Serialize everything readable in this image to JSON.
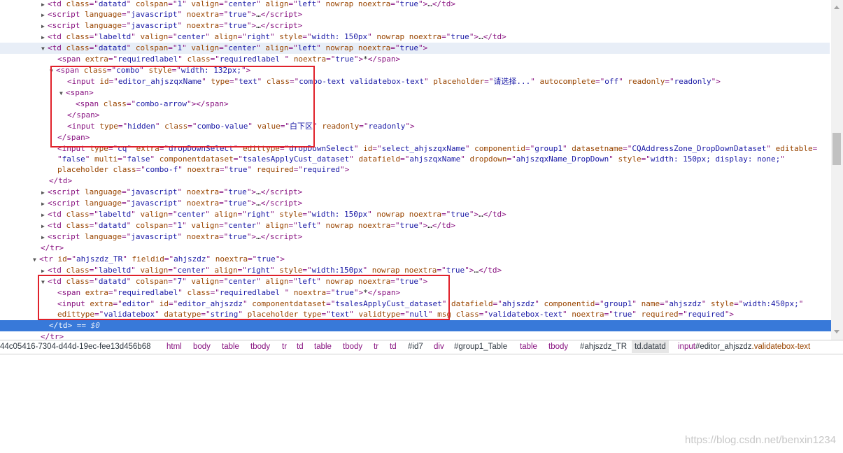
{
  "elements": {
    "lines": [
      {
        "arrow": "▶",
        "html": "<span class=\"tag\">&lt;td </span><span class=\"an\">class</span><span class=\"tag\">=\"</span><span class=\"av\">datatd</span><span class=\"tag\">\" </span><span class=\"an\">colspan</span><span class=\"tag\">=\"</span><span class=\"av\">1</span><span class=\"tag\">\" </span><span class=\"an\">valign</span><span class=\"tag\">=\"</span><span class=\"av\">center</span><span class=\"tag\">\" </span><span class=\"an\">align</span><span class=\"tag\">=\"</span><span class=\"av\">left</span><span class=\"tag\">\" </span><span class=\"an\">nowrap noextra</span><span class=\"tag\">=\"</span><span class=\"av\">true</span><span class=\"tag\">\"&gt;</span>…<span class=\"tag\">&lt;/td&gt;</span>"
      },
      {
        "arrow": "▶",
        "html": "<span class=\"tag\">&lt;script </span><span class=\"an\">language</span><span class=\"tag\">=\"</span><span class=\"av\">javascript</span><span class=\"tag\">\" </span><span class=\"an\">noextra</span><span class=\"tag\">=\"</span><span class=\"av\">true</span><span class=\"tag\">\"&gt;</span>…<span class=\"tag\">&lt;/script&gt;</span>"
      },
      {
        "arrow": "▶",
        "html": "<span class=\"tag\">&lt;script </span><span class=\"an\">language</span><span class=\"tag\">=\"</span><span class=\"av\">javascript</span><span class=\"tag\">\" </span><span class=\"an\">noextra</span><span class=\"tag\">=\"</span><span class=\"av\">true</span><span class=\"tag\">\"&gt;</span>…<span class=\"tag\">&lt;/script&gt;</span>"
      },
      {
        "arrow": "▶",
        "html": "<span class=\"tag\">&lt;td </span><span class=\"an\">class</span><span class=\"tag\">=\"</span><span class=\"av\">labeltd</span><span class=\"tag\">\" </span><span class=\"an\">valign</span><span class=\"tag\">=\"</span><span class=\"av\">center</span><span class=\"tag\">\" </span><span class=\"an\">align</span><span class=\"tag\">=\"</span><span class=\"av\">right</span><span class=\"tag\">\" </span><span class=\"an\">style</span><span class=\"tag\">=\"</span><span class=\"av\">width: 150px</span><span class=\"tag\">\" </span><span class=\"an\">nowrap noextra</span><span class=\"tag\">=\"</span><span class=\"av\">true</span><span class=\"tag\">\"&gt;</span>…<span class=\"tag\">&lt;/td&gt;</span>"
      },
      {
        "arrow": "▼",
        "html": "<span class=\"tag\">&lt;td </span><span class=\"an\">class</span><span class=\"tag\">=\"</span><span class=\"av\">datatd</span><span class=\"tag\">\" </span><span class=\"an\">colspan</span><span class=\"tag\">=\"</span><span class=\"av\">1</span><span class=\"tag\">\" </span><span class=\"an\">valign</span><span class=\"tag\">=\"</span><span class=\"av\">center</span><span class=\"tag\">\" </span><span class=\"an\">align</span><span class=\"tag\">=\"</span><span class=\"av\">left</span><span class=\"tag\">\" </span><span class=\"an\">nowrap noextra</span><span class=\"tag\">=\"</span><span class=\"av\">true</span><span class=\"tag\">\"&gt;</span>"
      },
      {
        "arrow": "",
        "html": "<span class=\"tag\">&lt;span </span><span class=\"an\">extra</span><span class=\"tag\">=\"</span><span class=\"av\">requiredlabel</span><span class=\"tag\">\" </span><span class=\"an\">class</span><span class=\"tag\">=\"</span><span class=\"av\">requiredlabel </span><span class=\"tag\">\" </span><span class=\"an\">noextra</span><span class=\"tag\">=\"</span><span class=\"av\">true</span><span class=\"tag\">\"&gt;</span>*<span class=\"tag\">&lt;/span&gt;</span>"
      },
      {
        "arrow": "▼",
        "html": "<span class=\"tag\">&lt;span </span><span class=\"an\">class</span><span class=\"tag\">=\"</span><span class=\"av\">combo</span><span class=\"tag\">\" </span><span class=\"an\">style</span><span class=\"tag\">=\"</span><span class=\"av\">width: 132px;</span><span class=\"tag\">\"&gt;</span>"
      },
      {
        "arrow": "",
        "html": "<span class=\"tag\">&lt;input </span><span class=\"an\">id</span><span class=\"tag\">=\"</span><span class=\"av\">editor_ahjszqxName</span><span class=\"tag\">\" </span><span class=\"an\">type</span><span class=\"tag\">=\"</span><span class=\"av\">text</span><span class=\"tag\">\" </span><span class=\"an\">class</span><span class=\"tag\">=\"</span><span class=\"av\">combo-text validatebox-text</span><span class=\"tag\">\" </span><span class=\"an\">placeholder</span><span class=\"tag\">=\"</span><span class=\"av\">请选择...</span><span class=\"tag\">\" </span><span class=\"an\">autocomplete</span><span class=\"tag\">=\"</span><span class=\"av\">off</span><span class=\"tag\">\" </span><span class=\"an\">readonly</span><span class=\"tag\">=\"</span><span class=\"av\">readonly</span><span class=\"tag\">\"&gt;</span>"
      },
      {
        "arrow": "▼",
        "html": "<span class=\"tag\">&lt;span&gt;</span>"
      },
      {
        "arrow": "",
        "html": "<span class=\"tag\">&lt;span </span><span class=\"an\">class</span><span class=\"tag\">=\"</span><span class=\"av\">combo-arrow</span><span class=\"tag\">\"&gt;&lt;/span&gt;</span>"
      },
      {
        "arrow": "",
        "html": "<span class=\"tag\">&lt;/span&gt;</span>"
      },
      {
        "arrow": "",
        "html": "<span class=\"tag\">&lt;input </span><span class=\"an\">type</span><span class=\"tag\">=\"</span><span class=\"av\">hidden</span><span class=\"tag\">\" </span><span class=\"an\">class</span><span class=\"tag\">=\"</span><span class=\"av\">combo-value</span><span class=\"tag\">\" </span><span class=\"an\">value</span><span class=\"tag\">=\"</span><span class=\"av\">白下区</span><span class=\"tag\">\" </span><span class=\"an\">readonly</span><span class=\"tag\">=\"</span><span class=\"av\">readonly</span><span class=\"tag\">\"&gt;</span>"
      },
      {
        "arrow": "",
        "html": "<span class=\"tag\">&lt;/span&gt;</span>"
      },
      {
        "arrow": "",
        "html": "<span class=\"tag\">&lt;input </span><span class=\"an\">type</span><span class=\"tag\">=\"</span><span class=\"av\">cq</span><span class=\"tag\">\" </span><span class=\"an\">extra</span><span class=\"tag\">=\"</span><span class=\"av\">dropDownSelect</span><span class=\"tag\">\" </span><span class=\"an\">edittype</span><span class=\"tag\">=\"</span><span class=\"av\">dropDownSelect</span><span class=\"tag\">\" </span><span class=\"an\">id</span><span class=\"tag\">=\"</span><span class=\"av\">select_ahjszqxName</span><span class=\"tag\">\" </span><span class=\"an\">componentid</span><span class=\"tag\">=\"</span><span class=\"av\">group1</span><span class=\"tag\">\" </span><span class=\"an\">datasetname</span><span class=\"tag\">=\"</span><span class=\"av\">CQAddressZone_DropDownDataset</span><span class=\"tag\">\" </span><span class=\"an\">editable</span><span class=\"tag\">=</span>"
      },
      {
        "arrow": "",
        "html": "<span class=\"tag\">\"</span><span class=\"av\">false</span><span class=\"tag\">\" </span><span class=\"an\">multi</span><span class=\"tag\">=\"</span><span class=\"av\">false</span><span class=\"tag\">\" </span><span class=\"an\">componentdataset</span><span class=\"tag\">=\"</span><span class=\"av\">tsalesApplyCust_dataset</span><span class=\"tag\">\" </span><span class=\"an\">datafield</span><span class=\"tag\">=\"</span><span class=\"av\">ahjszqxName</span><span class=\"tag\">\" </span><span class=\"an\">dropdown</span><span class=\"tag\">=\"</span><span class=\"av\">ahjszqxName_DropDown</span><span class=\"tag\">\" </span><span class=\"an\">style</span><span class=\"tag\">=\"</span><span class=\"av\">width: 150px; display: none;</span><span class=\"tag\">\"</span>"
      },
      {
        "arrow": "",
        "html": "<span class=\"an\">placeholder class</span><span class=\"tag\">=\"</span><span class=\"av\">combo-f</span><span class=\"tag\">\" </span><span class=\"an\">noextra</span><span class=\"tag\">=\"</span><span class=\"av\">true</span><span class=\"tag\">\" </span><span class=\"an\">required</span><span class=\"tag\">=\"</span><span class=\"av\">required</span><span class=\"tag\">\"&gt;</span>"
      },
      {
        "arrow": "",
        "html": "<span class=\"tag\">&lt;/td&gt;</span>"
      },
      {
        "arrow": "▶",
        "html": "<span class=\"tag\">&lt;script </span><span class=\"an\">language</span><span class=\"tag\">=\"</span><span class=\"av\">javascript</span><span class=\"tag\">\" </span><span class=\"an\">noextra</span><span class=\"tag\">=\"</span><span class=\"av\">true</span><span class=\"tag\">\"&gt;</span>…<span class=\"tag\">&lt;/script&gt;</span>"
      },
      {
        "arrow": "▶",
        "html": "<span class=\"tag\">&lt;script </span><span class=\"an\">language</span><span class=\"tag\">=\"</span><span class=\"av\">javascript</span><span class=\"tag\">\" </span><span class=\"an\">noextra</span><span class=\"tag\">=\"</span><span class=\"av\">true</span><span class=\"tag\">\"&gt;</span>…<span class=\"tag\">&lt;/script&gt;</span>"
      },
      {
        "arrow": "▶",
        "html": "<span class=\"tag\">&lt;td </span><span class=\"an\">class</span><span class=\"tag\">=\"</span><span class=\"av\">labeltd</span><span class=\"tag\">\" </span><span class=\"an\">valign</span><span class=\"tag\">=\"</span><span class=\"av\">center</span><span class=\"tag\">\" </span><span class=\"an\">align</span><span class=\"tag\">=\"</span><span class=\"av\">right</span><span class=\"tag\">\" </span><span class=\"an\">style</span><span class=\"tag\">=\"</span><span class=\"av\">width: 150px</span><span class=\"tag\">\" </span><span class=\"an\">nowrap noextra</span><span class=\"tag\">=\"</span><span class=\"av\">true</span><span class=\"tag\">\"&gt;</span>…<span class=\"tag\">&lt;/td&gt;</span>"
      },
      {
        "arrow": "▶",
        "html": "<span class=\"tag\">&lt;td </span><span class=\"an\">class</span><span class=\"tag\">=\"</span><span class=\"av\">datatd</span><span class=\"tag\">\" </span><span class=\"an\">colspan</span><span class=\"tag\">=\"</span><span class=\"av\">1</span><span class=\"tag\">\" </span><span class=\"an\">valign</span><span class=\"tag\">=\"</span><span class=\"av\">center</span><span class=\"tag\">\" </span><span class=\"an\">align</span><span class=\"tag\">=\"</span><span class=\"av\">left</span><span class=\"tag\">\" </span><span class=\"an\">nowrap noextra</span><span class=\"tag\">=\"</span><span class=\"av\">true</span><span class=\"tag\">\"&gt;</span>…<span class=\"tag\">&lt;/td&gt;</span>"
      },
      {
        "arrow": "▶",
        "html": "<span class=\"tag\">&lt;script </span><span class=\"an\">language</span><span class=\"tag\">=\"</span><span class=\"av\">javascript</span><span class=\"tag\">\" </span><span class=\"an\">noextra</span><span class=\"tag\">=\"</span><span class=\"av\">true</span><span class=\"tag\">\"&gt;</span>…<span class=\"tag\">&lt;/script&gt;</span>"
      },
      {
        "arrow": "",
        "html": "<span class=\"tag\">&lt;/tr&gt;</span>"
      },
      {
        "arrow": "▼",
        "html": "<span class=\"tag\">&lt;tr </span><span class=\"an\">id</span><span class=\"tag\">=\"</span><span class=\"av\">ahjszdz_TR</span><span class=\"tag\">\" </span><span class=\"an\">fieldid</span><span class=\"tag\">=\"</span><span class=\"av\">ahjszdz</span><span class=\"tag\">\" </span><span class=\"an\">noextra</span><span class=\"tag\">=\"</span><span class=\"av\">true</span><span class=\"tag\">\"&gt;</span>"
      },
      {
        "arrow": "▶",
        "html": "<span class=\"tag\">&lt;td </span><span class=\"an\">class</span><span class=\"tag\">=\"</span><span class=\"av\">labeltd</span><span class=\"tag\">\" </span><span class=\"an\">valign</span><span class=\"tag\">=\"</span><span class=\"av\">center</span><span class=\"tag\">\" </span><span class=\"an\">align</span><span class=\"tag\">=\"</span><span class=\"av\">right</span><span class=\"tag\">\" </span><span class=\"an\">style</span><span class=\"tag\">=\"</span><span class=\"av\">width:150px</span><span class=\"tag\">\" </span><span class=\"an\">nowrap noextra</span><span class=\"tag\">=\"</span><span class=\"av\">true</span><span class=\"tag\">\"&gt;</span>…<span class=\"tag\">&lt;/td&gt;</span>"
      },
      {
        "arrow": "▼",
        "html": "<span class=\"tag\">&lt;td </span><span class=\"an\">class</span><span class=\"tag\">=\"</span><span class=\"av\">datatd</span><span class=\"tag\">\" </span><span class=\"an\">colspan</span><span class=\"tag\">=\"</span><span class=\"av\">7</span><span class=\"tag\">\" </span><span class=\"an\">valign</span><span class=\"tag\">=\"</span><span class=\"av\">center</span><span class=\"tag\">\" </span><span class=\"an\">align</span><span class=\"tag\">=\"</span><span class=\"av\">left</span><span class=\"tag\">\" </span><span class=\"an\">nowrap noextra</span><span class=\"tag\">=\"</span><span class=\"av\">true</span><span class=\"tag\">\"&gt;</span>"
      },
      {
        "arrow": "",
        "html": "<span class=\"tag\">&lt;span </span><span class=\"an\">extra</span><span class=\"tag\">=\"</span><span class=\"av\">requiredlabel</span><span class=\"tag\">\" </span><span class=\"an\">class</span><span class=\"tag\">=\"</span><span class=\"av\">requiredlabel </span><span class=\"tag\">\" </span><span class=\"an\">noextra</span><span class=\"tag\">=\"</span><span class=\"av\">true</span><span class=\"tag\">\"&gt;</span>*<span class=\"tag\">&lt;/span&gt;</span>"
      },
      {
        "arrow": "",
        "html": "<span class=\"tag\">&lt;input </span><span class=\"an\">extra</span><span class=\"tag\">=\"</span><span class=\"av\">editor</span><span class=\"tag\">\" </span><span class=\"an\">id</span><span class=\"tag\">=\"</span><span class=\"av\">editor_ahjszdz</span><span class=\"tag\">\" </span><span class=\"an\">componentdataset</span><span class=\"tag\">=\"</span><span class=\"av\">tsalesApplyCust_dataset</span><span class=\"tag\">\" </span><span class=\"an\">datafield</span><span class=\"tag\">=\"</span><span class=\"av\">ahjszdz</span><span class=\"tag\">\" </span><span class=\"an\">componentid</span><span class=\"tag\">=\"</span><span class=\"av\">group1</span><span class=\"tag\">\" </span><span class=\"an\">name</span><span class=\"tag\">=\"</span><span class=\"av\">ahjszdz</span><span class=\"tag\">\" </span><span class=\"an\">style</span><span class=\"tag\">=\"</span><span class=\"av\">width:450px;</span><span class=\"tag\">\"</span>"
      },
      {
        "arrow": "",
        "html": "<span class=\"an\">edittype</span><span class=\"tag\">=\"</span><span class=\"av\">validatebox</span><span class=\"tag\">\" </span><span class=\"an\">datatype</span><span class=\"tag\">=\"</span><span class=\"av\">string</span><span class=\"tag\">\" </span><span class=\"an\">placeholder type</span><span class=\"tag\">=\"</span><span class=\"av\">text</span><span class=\"tag\">\" </span><span class=\"an\">validtype</span><span class=\"tag\">=\"</span><span class=\"av\">null</span><span class=\"tag\">\" </span><span class=\"an\">msg class</span><span class=\"tag\">=\"</span><span class=\"av\">validatebox-text</span><span class=\"tag\">\" </span><span class=\"an\">noextra</span><span class=\"tag\">=\"</span><span class=\"av\">true</span><span class=\"tag\">\" </span><span class=\"an\">required</span><span class=\"tag\">=\"</span><span class=\"av\">required</span><span class=\"tag\">\"&gt;</span>"
      },
      {
        "arrow": "",
        "html": "<span class=\"tag\">&lt;/td&gt;</span> <span class=\"txt\">==</span> <span class=\"dollar\">$0</span>"
      },
      {
        "arrow": "",
        "html": "<span class=\"tag\">&lt;/tr&gt;</span>"
      }
    ]
  },
  "breadcrumb": {
    "items": [
      {
        "text": "44c05416-7304-d44d-19ec-fee13d456b68",
        "kind": "plain"
      },
      {
        "text": "html",
        "kind": "tag"
      },
      {
        "text": "body",
        "kind": "tag"
      },
      {
        "text": "table",
        "kind": "tag"
      },
      {
        "text": "tbody",
        "kind": "tag"
      },
      {
        "text": "tr",
        "kind": "tag"
      },
      {
        "text": "td",
        "kind": "tag"
      },
      {
        "text": "table",
        "kind": "tag"
      },
      {
        "text": "tbody",
        "kind": "tag"
      },
      {
        "text": "tr",
        "kind": "tag"
      },
      {
        "text": "td",
        "kind": "tag"
      },
      {
        "text": "#id7",
        "kind": "plain"
      },
      {
        "text": "div",
        "kind": "tag"
      },
      {
        "text": "#group1_Table",
        "kind": "plain"
      },
      {
        "text": "table",
        "kind": "tag"
      },
      {
        "text": "tbody",
        "kind": "tag"
      },
      {
        "text": "#ahjszdz_TR",
        "kind": "plain"
      },
      {
        "text": "td.datatd",
        "kind": "current"
      },
      {
        "text": "input#editor_ahjszdz.validatebox-text",
        "kind": "input"
      }
    ]
  },
  "watermark": "https://blog.csdn.net/benxin1234",
  "colors": {
    "tag": "#881280",
    "attr_name": "#994500",
    "attr_value": "#1a1aa6",
    "selected_row": "#3879d9",
    "hover_row": "#e8eef7",
    "annotation_box": "#e0212b"
  }
}
